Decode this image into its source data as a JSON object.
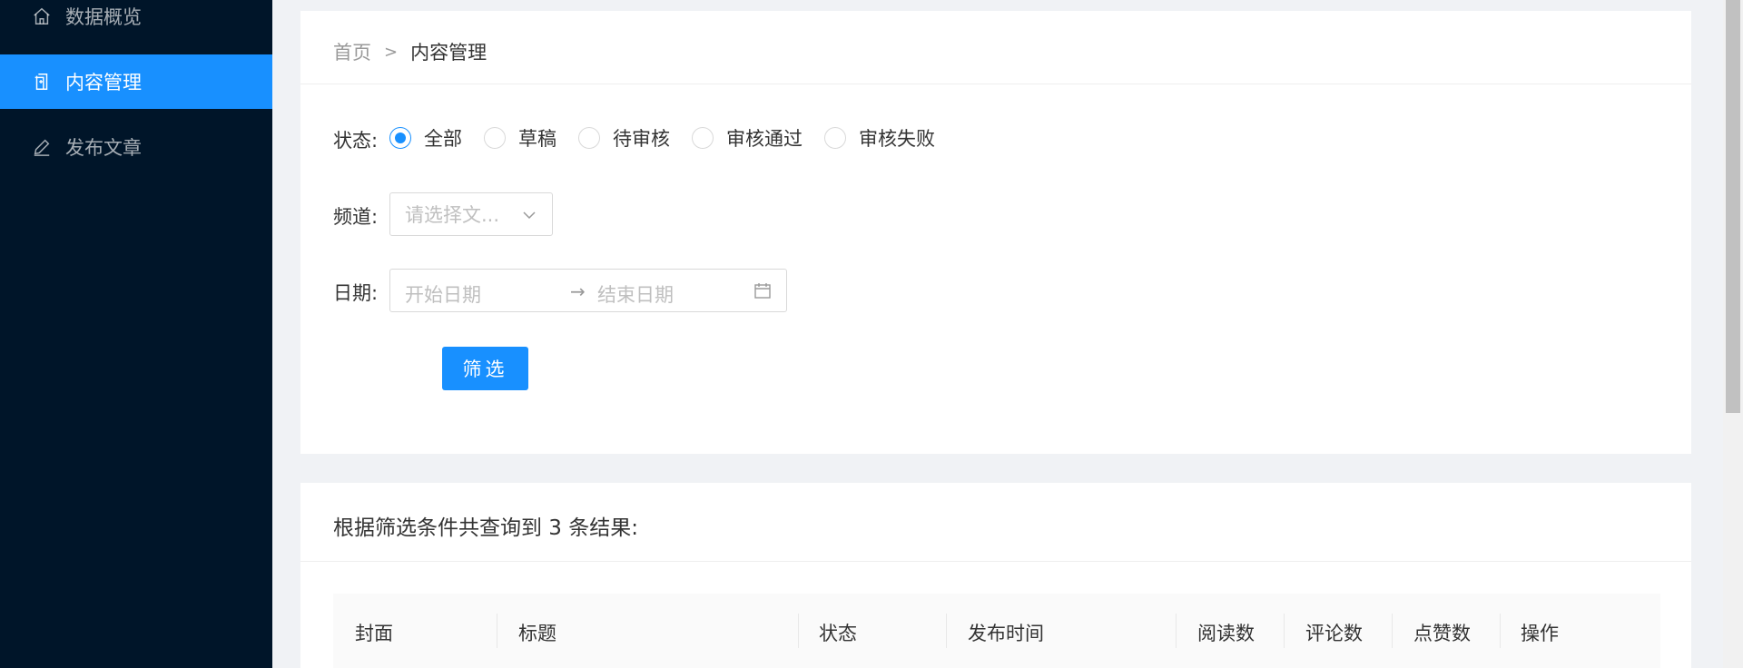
{
  "sidebar": {
    "items": [
      {
        "label": "数据概览",
        "icon": "home-icon"
      },
      {
        "label": "内容管理",
        "icon": "document-icon",
        "active": true
      },
      {
        "label": "发布文章",
        "icon": "edit-icon"
      }
    ]
  },
  "breadcrumb": {
    "home": "首页",
    "separator": ">",
    "current": "内容管理"
  },
  "filter": {
    "status_label": "状态:",
    "status_options": [
      "全部",
      "草稿",
      "待审核",
      "审核通过",
      "审核失败"
    ],
    "status_selected": "全部",
    "channel_label": "频道:",
    "channel_placeholder": "请选择文...",
    "date_label": "日期:",
    "date_start_placeholder": "开始日期",
    "date_end_placeholder": "结束日期",
    "date_arrow": "→",
    "submit_label": "筛选"
  },
  "results": {
    "title": "根据筛选条件共查询到 3 条结果:",
    "columns": [
      "封面",
      "标题",
      "状态",
      "发布时间",
      "阅读数",
      "评论数",
      "点赞数",
      "操作"
    ]
  },
  "colors": {
    "primary": "#1890ff",
    "sidebar_bg": "#001529"
  }
}
